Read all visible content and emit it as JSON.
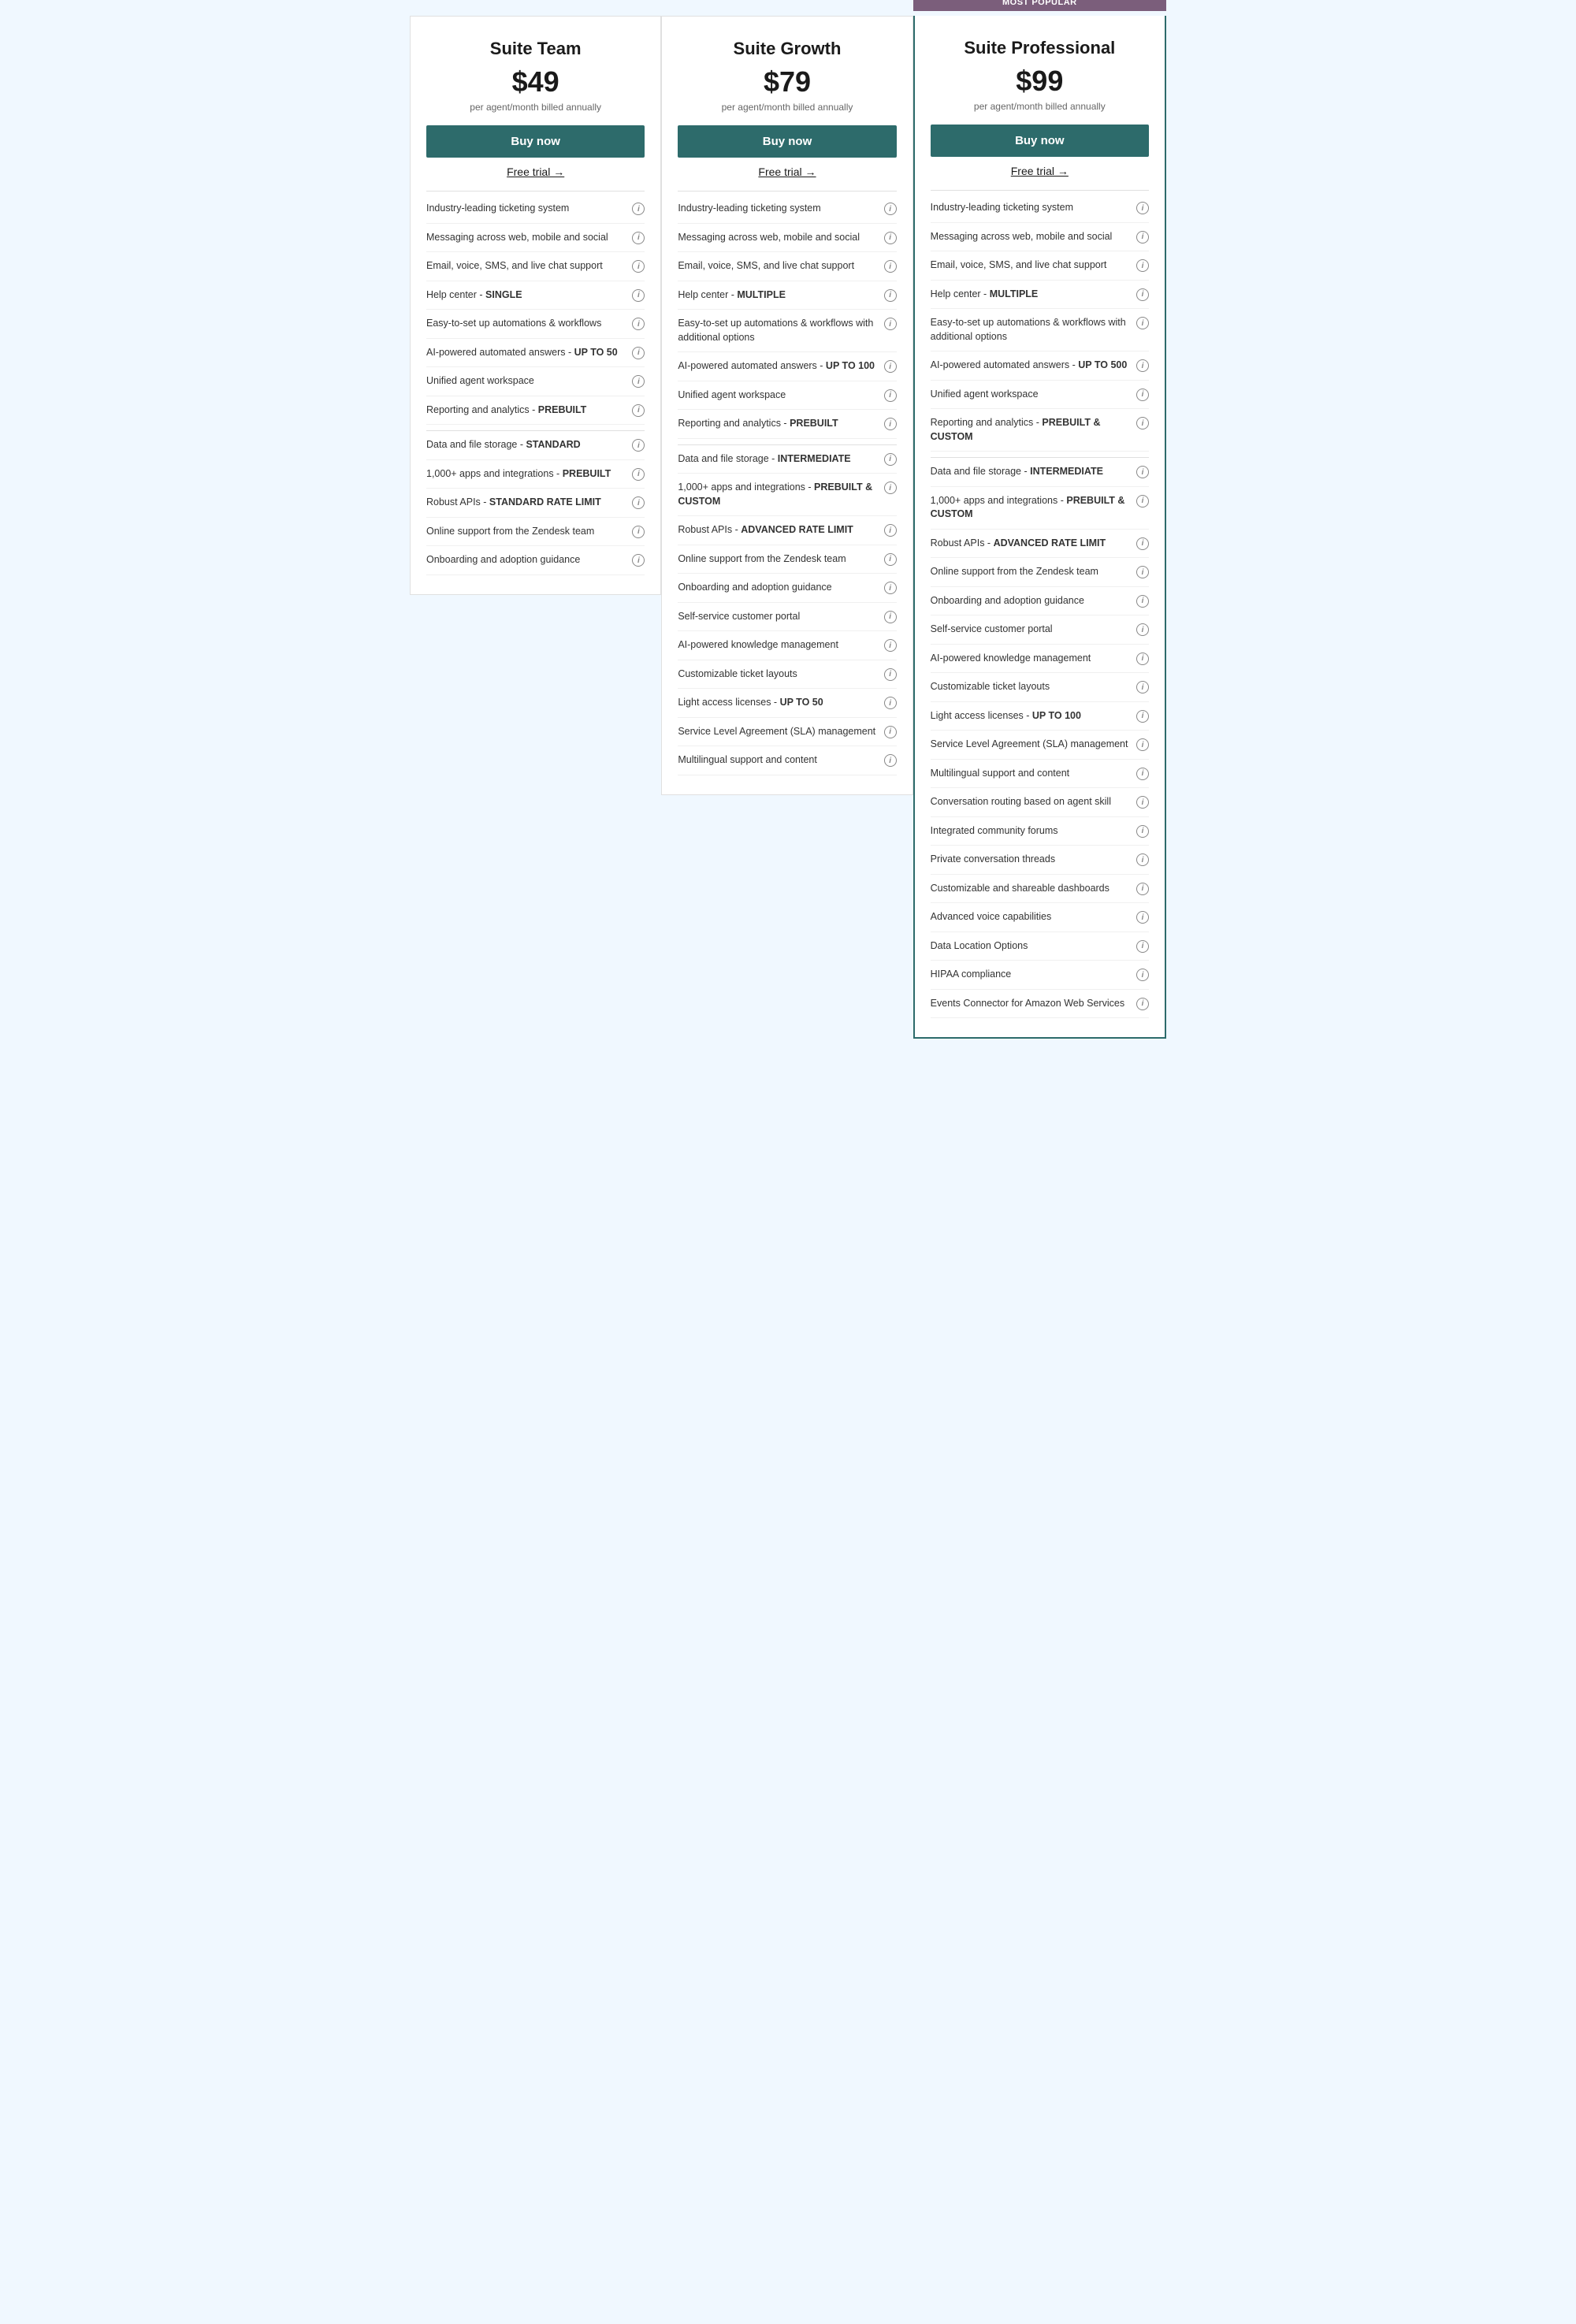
{
  "plans": [
    {
      "id": "suite-team",
      "title": "Suite Team",
      "price": "$49",
      "billing": "per agent/month billed annually",
      "buy_label": "Buy now",
      "free_trial_label": "Free trial →",
      "featured": false,
      "most_popular": false,
      "feature_groups": [
        [
          {
            "text": "Industry-leading ticketing system"
          },
          {
            "text": "Messaging across web, mobile and social"
          },
          {
            "text": "Email, voice, SMS, and live chat support"
          },
          {
            "text": "Help center - <strong>SINGLE</strong>"
          },
          {
            "text": "Easy-to-set up automations & workflows"
          },
          {
            "text": "AI-powered automated answers - <strong>UP TO 50</strong>"
          },
          {
            "text": "Unified agent workspace"
          },
          {
            "text": "Reporting and analytics - <strong>PREBUILT</strong>"
          }
        ],
        [
          {
            "text": "Data and file storage - <strong>STANDARD</strong>"
          },
          {
            "text": "1,000+ apps and integrations - <strong>PREBUILT</strong>"
          },
          {
            "text": "Robust APIs - <strong>STANDARD RATE LIMIT</strong>"
          },
          {
            "text": "Online support from the Zendesk team"
          },
          {
            "text": "Onboarding and adoption guidance"
          }
        ]
      ]
    },
    {
      "id": "suite-growth",
      "title": "Suite Growth",
      "price": "$79",
      "billing": "per agent/month billed annually",
      "buy_label": "Buy now",
      "free_trial_label": "Free trial →",
      "featured": false,
      "most_popular": false,
      "feature_groups": [
        [
          {
            "text": "Industry-leading ticketing system"
          },
          {
            "text": "Messaging across web, mobile and social"
          },
          {
            "text": "Email, voice, SMS, and live chat support"
          },
          {
            "text": "Help center - <strong>MULTIPLE</strong>"
          },
          {
            "text": "Easy-to-set up automations & workflows with additional options"
          },
          {
            "text": "AI-powered automated answers - <strong>UP TO 100</strong>"
          },
          {
            "text": "Unified agent workspace"
          },
          {
            "text": "Reporting and analytics - <strong>PREBUILT</strong>"
          }
        ],
        [
          {
            "text": "Data and file storage - <strong>INTERMEDIATE</strong>"
          },
          {
            "text": "1,000+ apps and integrations - <strong>PREBUILT & CUSTOM</strong>"
          },
          {
            "text": "Robust APIs - <strong>ADVANCED RATE LIMIT</strong>"
          },
          {
            "text": "Online support from the Zendesk team"
          },
          {
            "text": "Onboarding and adoption guidance"
          },
          {
            "text": "Self-service customer portal"
          },
          {
            "text": "AI-powered knowledge management"
          },
          {
            "text": "Customizable ticket layouts"
          },
          {
            "text": "Light access licenses - <strong>UP TO 50</strong>"
          },
          {
            "text": "Service Level Agreement (SLA) management"
          },
          {
            "text": "Multilingual support and content"
          }
        ]
      ]
    },
    {
      "id": "suite-professional",
      "title": "Suite Professional",
      "price": "$99",
      "billing": "per agent/month billed annually",
      "buy_label": "Buy now",
      "free_trial_label": "Free trial →",
      "featured": true,
      "most_popular": true,
      "most_popular_label": "Most popular",
      "feature_groups": [
        [
          {
            "text": "Industry-leading ticketing system"
          },
          {
            "text": "Messaging across web, mobile and social"
          },
          {
            "text": "Email, voice, SMS, and live chat support"
          },
          {
            "text": "Help center - <strong>MULTIPLE</strong>"
          },
          {
            "text": "Easy-to-set up automations & workflows with additional options"
          },
          {
            "text": "AI-powered automated answers - <strong>UP TO 500</strong>"
          },
          {
            "text": "Unified agent workspace"
          },
          {
            "text": "Reporting and analytics - <strong>PREBUILT & CUSTOM</strong>"
          }
        ],
        [
          {
            "text": "Data and file storage - <strong>INTERMEDIATE</strong>"
          },
          {
            "text": "1,000+ apps and integrations - <strong>PREBUILT & CUSTOM</strong>"
          },
          {
            "text": "Robust APIs - <strong>ADVANCED RATE LIMIT</strong>"
          },
          {
            "text": "Online support from the Zendesk team"
          },
          {
            "text": "Onboarding and adoption guidance"
          },
          {
            "text": "Self-service customer portal"
          },
          {
            "text": "AI-powered knowledge management"
          },
          {
            "text": "Customizable ticket layouts"
          },
          {
            "text": "Light access licenses - <strong>UP TO 100</strong>"
          },
          {
            "text": "Service Level Agreement (SLA) management"
          },
          {
            "text": "Multilingual support and content"
          },
          {
            "text": "Conversation routing based on agent skill"
          },
          {
            "text": "Integrated community forums"
          },
          {
            "text": "Private conversation threads"
          },
          {
            "text": "Customizable and shareable dashboards"
          },
          {
            "text": "Advanced voice capabilities"
          },
          {
            "text": "Data Location Options"
          },
          {
            "text": "HIPAA compliance"
          },
          {
            "text": "Events Connector for Amazon Web Services"
          }
        ]
      ]
    }
  ]
}
